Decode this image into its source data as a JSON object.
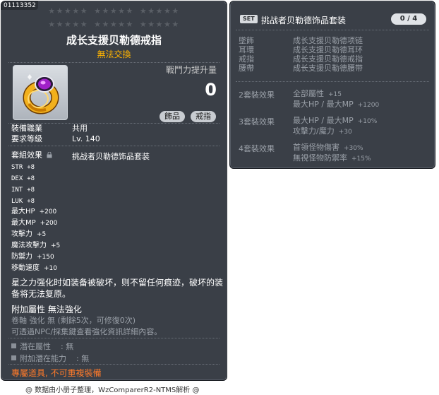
{
  "item": {
    "id": "01113352",
    "title": "成长支援贝勒德戒指",
    "trade": "無法交換",
    "power_label": "戰鬥力提升量",
    "power_value": "0",
    "category_badges": [
      "飾品",
      "戒指"
    ],
    "job_label": "裝備職業",
    "job_value": "共用",
    "level_label": "要求等級",
    "level_value": "Lv. 140",
    "set_label": "套組效果",
    "set_name": "挑战者贝勒德饰品套装",
    "stats": [
      {
        "name": "STR",
        "value": "+8"
      },
      {
        "name": "DEX",
        "value": "+8"
      },
      {
        "name": "INT",
        "value": "+8"
      },
      {
        "name": "LUK",
        "value": "+8"
      },
      {
        "name": "最大HP",
        "value": "+200"
      },
      {
        "name": "最大MP",
        "value": "+200"
      },
      {
        "name": "攻擊力",
        "value": "+5"
      },
      {
        "name": "魔法攻擊力",
        "value": "+5"
      },
      {
        "name": "防禦力",
        "value": "+150"
      },
      {
        "name": "移動速度",
        "value": "+10"
      }
    ],
    "description": "星之力强化时如装备被破坏，则不留任何痕迹，破坏的装备将无法复原。",
    "additional_label": "附加屬性 無法強化",
    "scroll_info": "卷軸 強化 無 (剩餘5次，可修復0次)",
    "npc_info": "可透過NPC/採集鍵查看強化資訊詳細內容。",
    "potential_label": "潛在屬性",
    "potential_value": ": 無",
    "bonus_potential_label": "附加潛在能力",
    "bonus_potential_value": ": 無",
    "exclusive": "專屬道具, 不可重複裝備",
    "footer": "@ 数据由小册子整理，WzComparerR2-NTMS解析 @"
  },
  "set_panel": {
    "badge": "SET",
    "title": "挑战者贝勒德饰品套装",
    "count": "0 / 4",
    "parts": [
      {
        "slot": "墜飾",
        "item": "成长支援贝勒德项链"
      },
      {
        "slot": "耳環",
        "item": "成长支援贝勒德耳环"
      },
      {
        "slot": "戒指",
        "item": "成长支援贝勒德戒指"
      },
      {
        "slot": "腰帶",
        "item": "成长支援贝勒德腰带"
      }
    ],
    "bonuses": [
      {
        "title": "2套裝效果",
        "lines": [
          {
            "label": "全部屬性",
            "value": "+15"
          },
          {
            "label": "最大HP / 最大MP",
            "value": "+1200"
          }
        ]
      },
      {
        "title": "3套裝效果",
        "lines": [
          {
            "label": "最大HP / 最大MP",
            "value": "+10%"
          },
          {
            "label": "攻擊力/魔力",
            "value": "+30"
          }
        ]
      },
      {
        "title": "4套裝效果",
        "lines": [
          {
            "label": "首領怪物傷害",
            "value": "+30%"
          },
          {
            "label": "無視怪物防禦率",
            "value": "+15%"
          }
        ]
      }
    ]
  },
  "colors": {
    "panel_bg": "#3a3f47",
    "trade_text": "#ffb400",
    "exclusive_text": "#ff7a2a",
    "muted_text": "#9aa0a8"
  },
  "icons": {
    "item": "gold-ring-purple-gem-icon",
    "set_lock": "lock-icon"
  }
}
